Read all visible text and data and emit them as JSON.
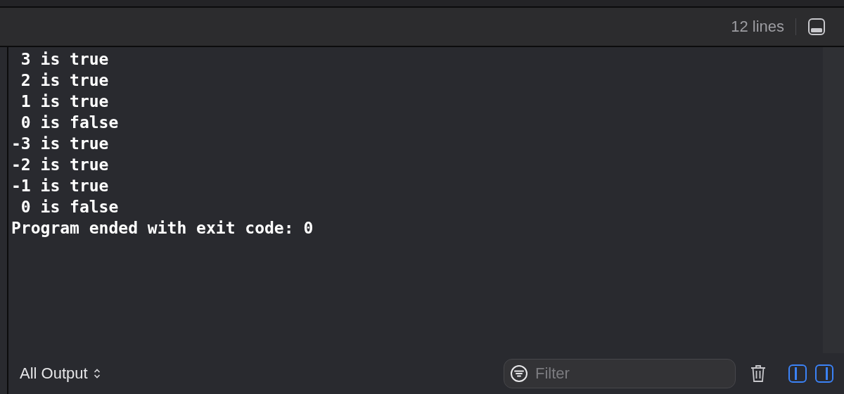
{
  "header": {
    "line_count": "12 lines"
  },
  "console": {
    "lines": [
      " 3 is true",
      " 2 is true",
      " 1 is true",
      " 0 is false",
      "-3 is true",
      "-2 is true",
      "-1 is true",
      " 0 is false",
      "Program ended with exit code: 0"
    ]
  },
  "footer": {
    "output_selector": "All Output",
    "filter": {
      "placeholder": "Filter"
    }
  }
}
